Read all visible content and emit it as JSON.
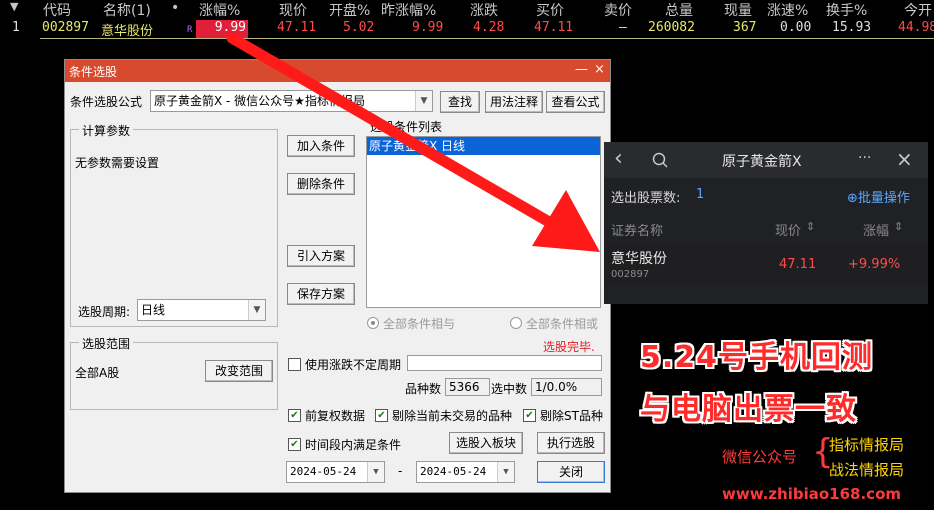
{
  "quote_header": {
    "dropdown_mark": "▼",
    "cols": [
      "代码",
      "名称(1)",
      "•",
      "涨幅%",
      "现价",
      "开盘%",
      "昨涨幅%",
      "涨跌",
      "买价",
      "卖价",
      "总量",
      "现量",
      "涨速%",
      "换手%",
      "今开"
    ]
  },
  "quote_row": {
    "index": "1",
    "code": "002897",
    "name": "意华股份",
    "tag": "R",
    "change_pct": "9.99",
    "price": "47.11",
    "open_pct": "5.02",
    "prev_change_pct": "9.99",
    "change": "4.28",
    "bid": "47.11",
    "ask": "–",
    "volume": "260082",
    "cur_volume": "367",
    "speed": "0.00",
    "turnover": "15.93",
    "open": "44.98"
  },
  "dialog": {
    "title": "条件选股",
    "min_btn": "—",
    "close_btn": "×",
    "formula_label": "条件选股公式",
    "formula_value": "原子黄金箭X  - 微信公众号★指标情报局",
    "search_btn": "查找",
    "usage_btn": "用法注释",
    "view_btn": "查看公式",
    "calc_group": "计算参数",
    "no_params": "无参数需要设置",
    "period_label": "选股周期:",
    "period_value": "日线",
    "add_btn": "加入条件",
    "delete_btn": "删除条件",
    "import_btn": "引入方案",
    "save_btn": "保存方案",
    "list_label": "选股条件列表",
    "list_items": [
      "原子黄金箭X  日线"
    ],
    "radio_and": "全部条件相与",
    "radio_or": "全部条件相或",
    "status": "选股完毕.",
    "scope_group": "选股范围",
    "scope_value": "全部A股",
    "change_scope_btn": "改变范围",
    "use_range_label": "使用涨跌不定周期",
    "count_label": "品种数",
    "count_value": "5366",
    "selected_label": "选中数",
    "selected_value": "1/0.0%",
    "prev_adj_label": "前复权数据",
    "exclude_halt_label": "剔除当前未交易的品种",
    "exclude_st_label": "剔除ST品种",
    "time_range_label": "时间段内满足条件",
    "to_block_btn": "选股入板块",
    "run_btn": "执行选股",
    "date_from": "2024-05-24",
    "date_sep": "-",
    "date_to": "2024-05-24",
    "close_label": "关闭"
  },
  "phone": {
    "back": "‹",
    "title": "原子黄金箭X",
    "more": "···",
    "close": "×",
    "count_label": "选出股票数:",
    "count_value": "1",
    "batch_label": "⊕批量操作",
    "col_name": "证券名称",
    "col_price": "现价",
    "col_change": "涨幅",
    "sort_mark": "⇕",
    "row": {
      "name": "意华股份",
      "code": "002897",
      "price": "47.11",
      "change": "+9.99%"
    }
  },
  "promo": {
    "line1": "5.24号手机回测",
    "line2": "与电脑出票一致",
    "wechat_label": "微信公众号",
    "brace": "{",
    "item1": "指标情报局",
    "item2": "战法情报局",
    "url": "www.zhibiao168.com"
  },
  "colors": {
    "title_bar": "#d84a2e",
    "up": "#ff4b4b",
    "arrow": "#ff1a1a",
    "promo_red": "#ff2a2a",
    "promo_yellow": "#ffd500"
  }
}
